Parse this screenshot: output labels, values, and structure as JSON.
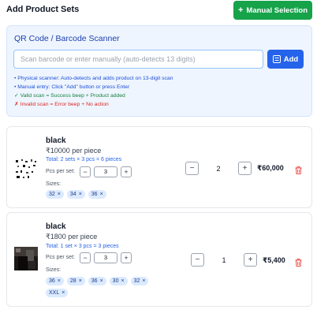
{
  "page": {
    "title": "Add Product Sets",
    "manual_selection_label": "Manual Selection"
  },
  "scanner": {
    "title": "QR Code / Barcode Scanner",
    "input_placeholder": "Scan barcode or enter manually (auto-detects 13 digits)",
    "input_value": "",
    "add_label": "Add",
    "hints": [
      "• Physical scanner: Auto-detects and adds product on 13-digit scan",
      "• Manual entry: Click \"Add\" button or press Enter",
      "✓ Valid scan = Success beep + Product added",
      "✗ Invalid scan = Error beep + No action"
    ]
  },
  "labels": {
    "pcs_per_set": "Pcs per set:",
    "sizes": "Sizes:",
    "minus": "−",
    "plus": "+",
    "chip_remove": "×"
  },
  "products": [
    {
      "name": "black",
      "price": "₹10000 per piece",
      "total": "Total: 2 sets × 3 pcs = 6 pieces",
      "pcs_per_set": "3",
      "sizes": [
        "32",
        "34",
        "36"
      ],
      "quantity": "2",
      "line_total": "₹60,000"
    },
    {
      "name": "black",
      "price": "₹1800 per piece",
      "total": "Total: 1 set × 3 pcs = 3 pieces",
      "pcs_per_set": "3",
      "sizes": [
        "36",
        "28",
        "36",
        "30",
        "32",
        "XXL"
      ],
      "quantity": "1",
      "line_total": "₹5,400"
    }
  ],
  "colors": {
    "primary_green": "#16a34a",
    "primary_blue": "#2563eb",
    "chip_bg": "#dbeafe",
    "delete_red": "#ef4444"
  }
}
